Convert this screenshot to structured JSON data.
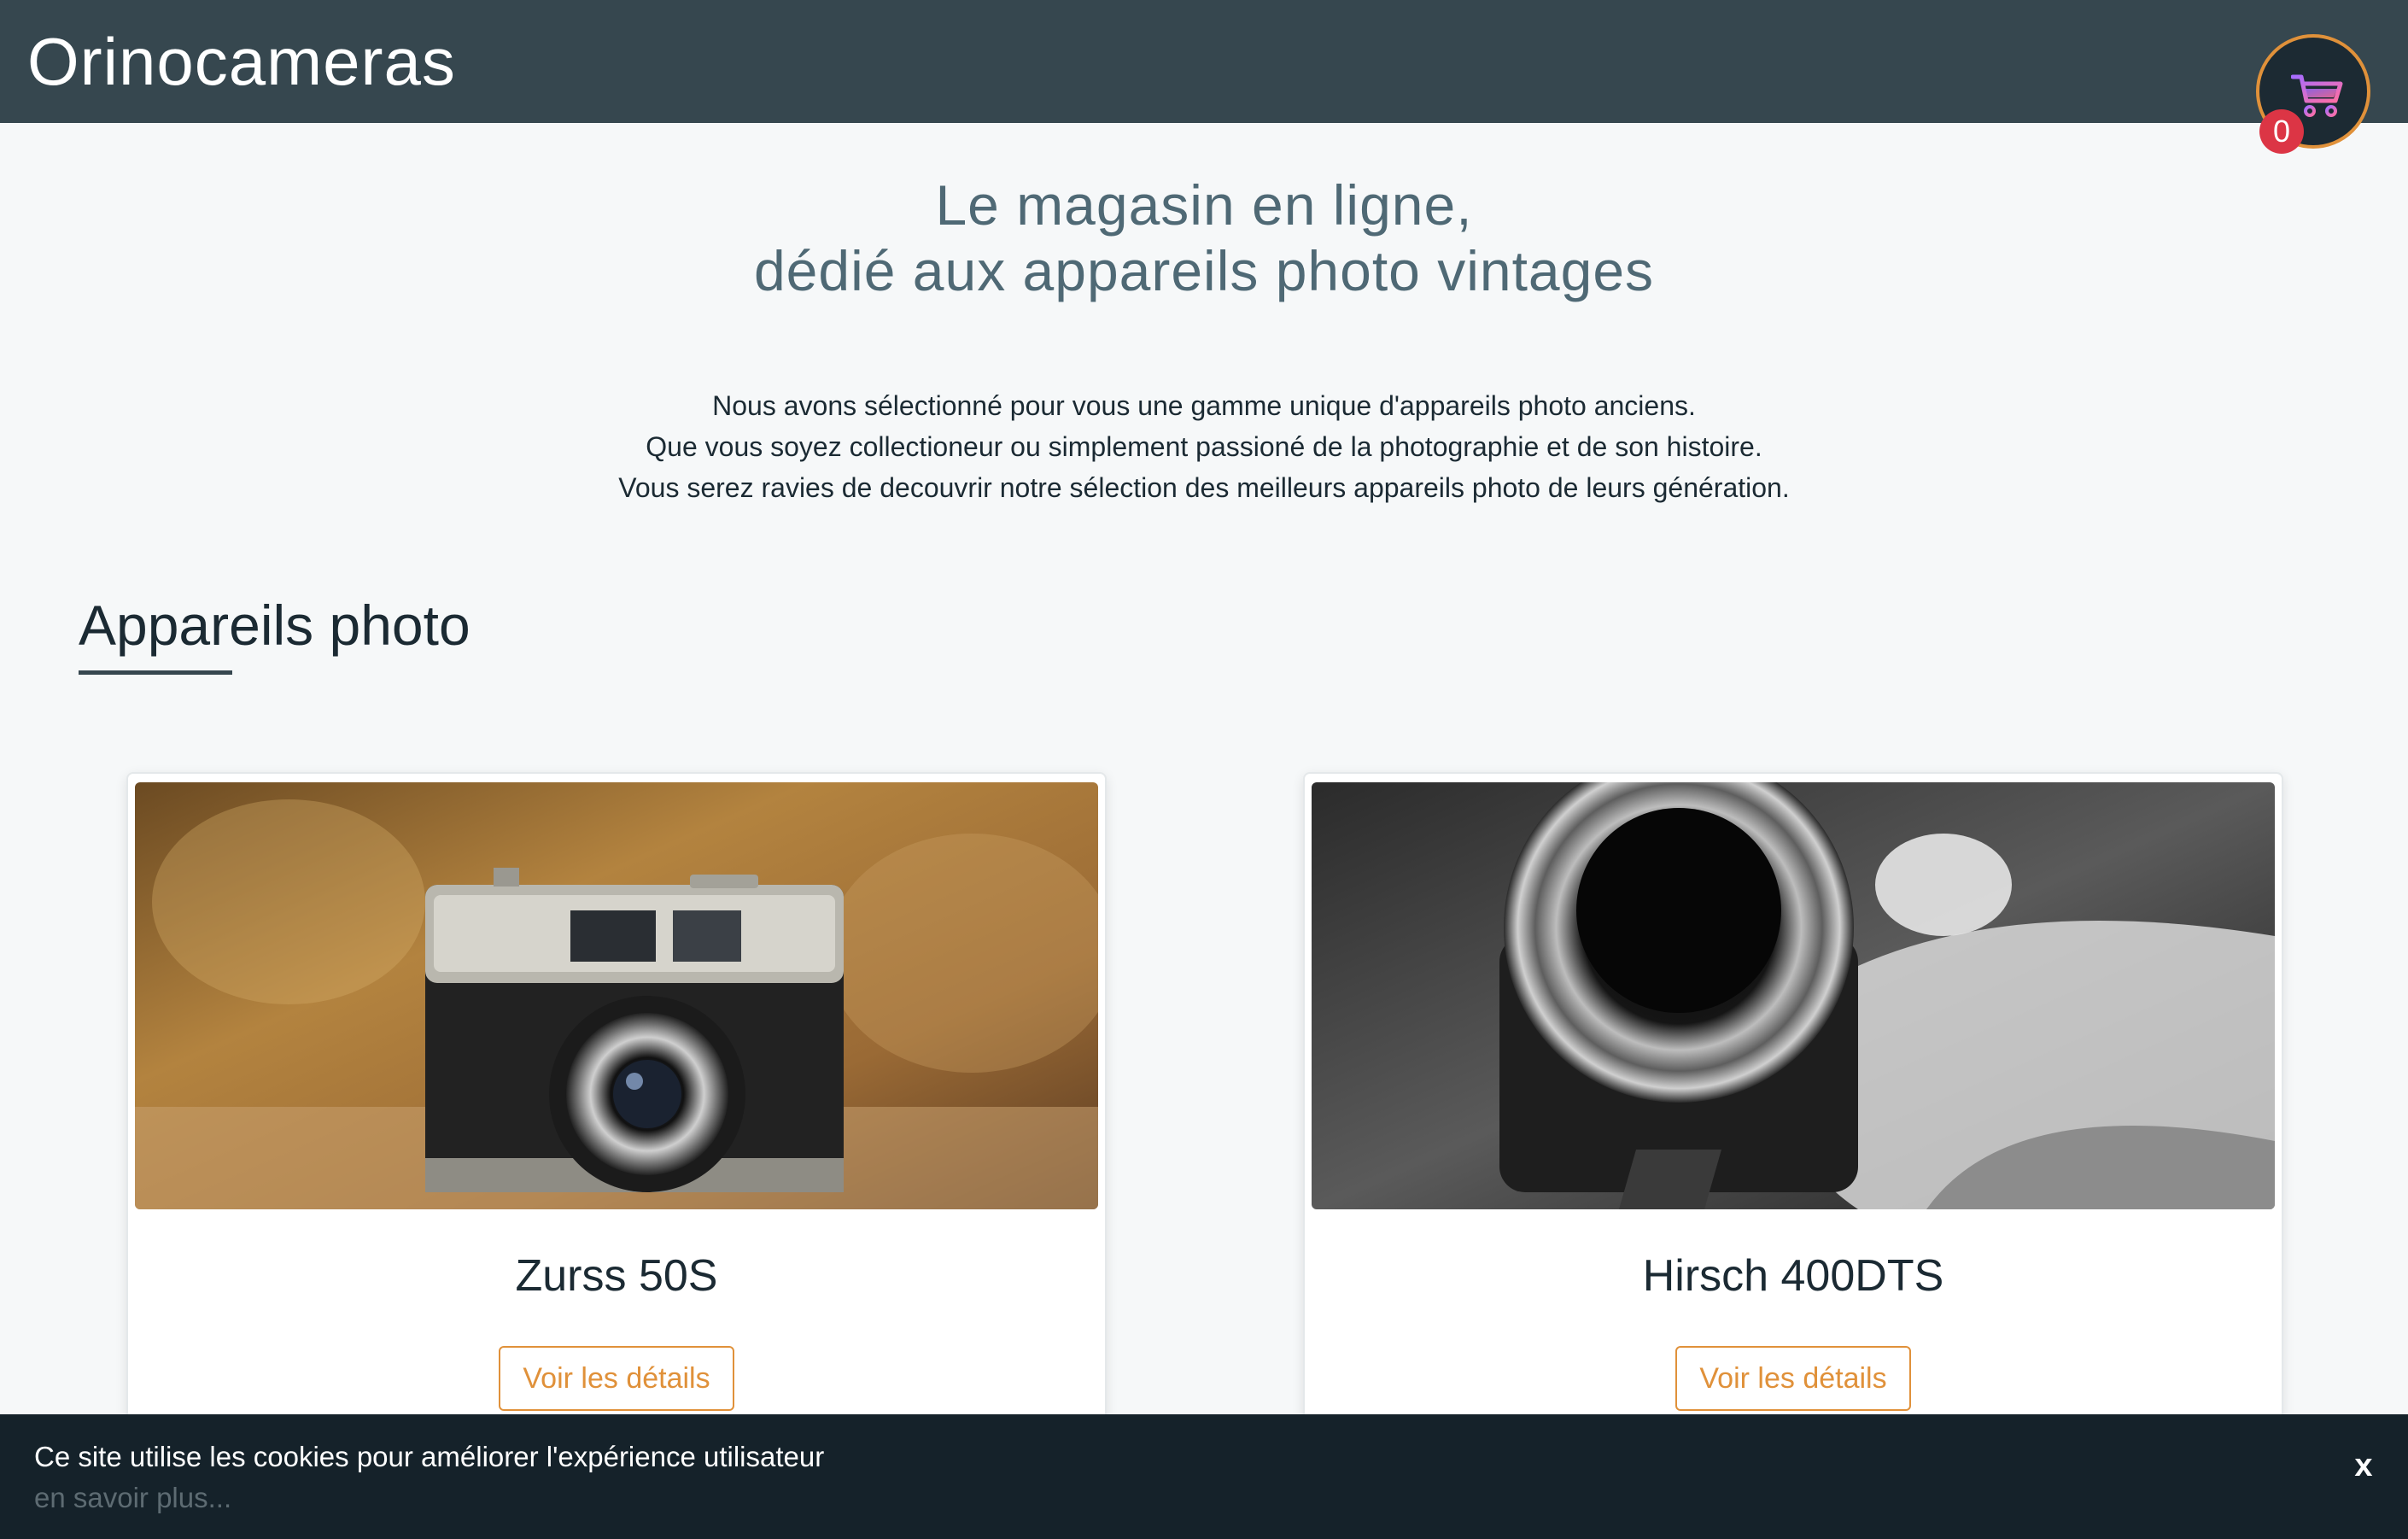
{
  "header": {
    "brand": "Orinocameras",
    "cart": {
      "count": "0",
      "icon": "shopping-cart-icon",
      "accent": "#e0913a"
    }
  },
  "hero": {
    "title_line1": "Le magasin en ligne,",
    "title_line2": "dédié aux appareils photo vintages"
  },
  "intro": {
    "line1": "Nous avons sélectionné pour vous une gamme unique d'appareils photo anciens.",
    "line2": "Que vous soyez collectioneur ou simplement passioné de la photographie et de son histoire.",
    "line3": "Vous serez ravies de decouvrir notre sélection des meilleurs appareils photo de leurs génération."
  },
  "section": {
    "title": "Appareils photo"
  },
  "products": [
    {
      "name": "Zurss 50S",
      "button_label": "Voir les détails"
    },
    {
      "name": "Hirsch 400DTS",
      "button_label": "Voir les détails"
    }
  ],
  "cookie_banner": {
    "message": "Ce site utilise les cookies pour améliorer l'expérience utilisateur",
    "link_text": "en savoir plus...",
    "close_label": "x"
  },
  "colors": {
    "header_bg": "#36474f",
    "accent": "#e0913a",
    "badge": "#dc3545",
    "cookie_bg": "#15222a"
  }
}
